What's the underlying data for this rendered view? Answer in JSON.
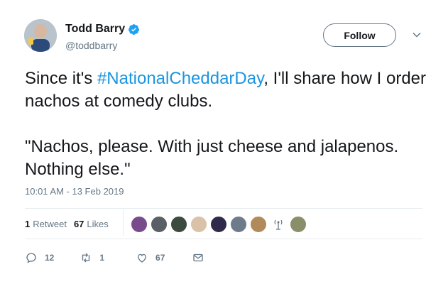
{
  "user": {
    "display_name": "Todd Barry",
    "handle": "@toddbarry",
    "verified": true
  },
  "follow_label": "Follow",
  "tweet": {
    "text_before": "Since it's ",
    "hashtag": "#NationalCheddarDay",
    "text_after": ", I'll share how I order nachos at comedy clubs.\n\n\"Nachos, please. With just cheese and jalapenos. Nothing else.\"",
    "timestamp": "10:01 AM - 13 Feb 2019"
  },
  "stats": {
    "retweets_count": "1",
    "retweets_label": "Retweet",
    "likes_count": "67",
    "likes_label": "Likes"
  },
  "likers": [
    {
      "color": "#7a4b8c"
    },
    {
      "color": "#5b5f66"
    },
    {
      "color": "#3c4a3f"
    },
    {
      "color": "#d9c2a7"
    },
    {
      "color": "#2e2a4a"
    },
    {
      "color": "#6d7b8a"
    },
    {
      "color": "#b08a5a"
    },
    {
      "color": "#ffffff"
    },
    {
      "color": "#8a8f6a"
    }
  ],
  "actions": {
    "reply_count": "12",
    "retweet_count": "1",
    "like_count": "67"
  },
  "colors": {
    "accent": "#1b95e0",
    "secondary_text": "#657786",
    "divider": "#e6ecf0"
  }
}
